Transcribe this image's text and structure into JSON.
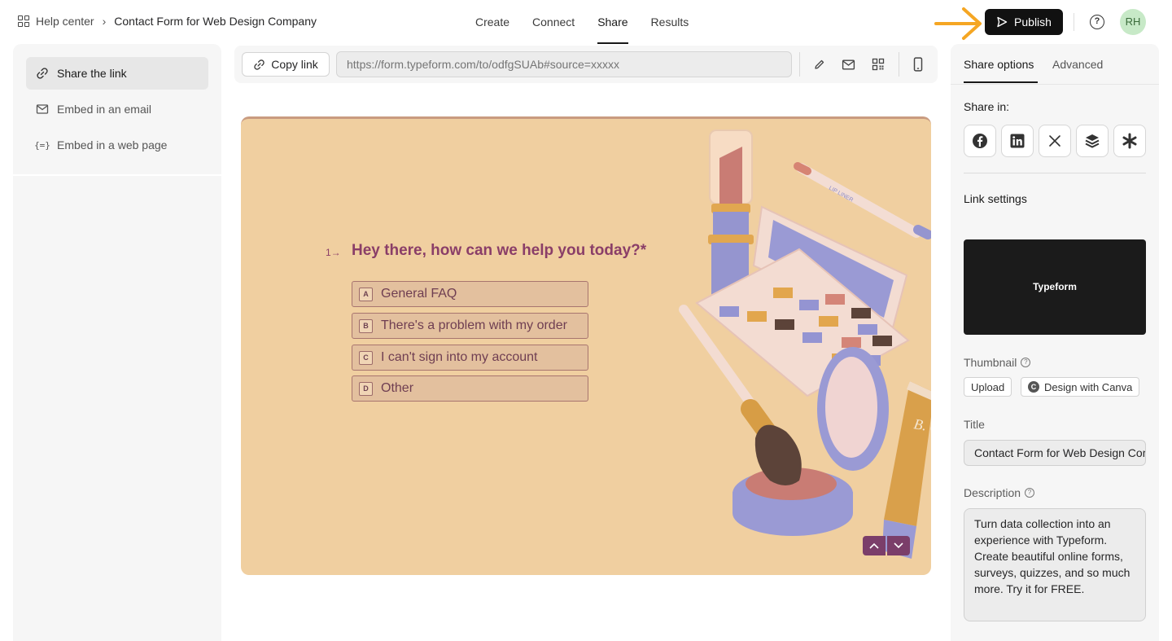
{
  "breadcrumb": {
    "home": "Help center",
    "separator": "›",
    "current": "Contact Form for Web Design Company"
  },
  "nav_tabs": [
    {
      "label": "Create"
    },
    {
      "label": "Connect"
    },
    {
      "label": "Share",
      "active": true
    },
    {
      "label": "Results"
    }
  ],
  "publish_label": "Publish",
  "help_icon": "?",
  "avatar_initials": "RH",
  "accent_color": "#f5a623",
  "left_menu": [
    {
      "label": "Share the link",
      "icon": "link-icon",
      "active": true
    },
    {
      "label": "Embed in an email",
      "icon": "mail-icon"
    },
    {
      "label": "Embed in a web page",
      "icon": "code-braces-icon",
      "glyph": "{=}"
    }
  ],
  "toolbar": {
    "copy_link_label": "Copy link",
    "url_placeholder": "https://form.typeform.com/to/odfgSUAb#source=xxxxx",
    "icons": [
      "pencil-icon",
      "mail-icon",
      "qr-code-icon",
      "mobile-preview-icon"
    ]
  },
  "form_preview": {
    "question_number": "1→",
    "question": "Hey there, how can we help you today?*",
    "choices": [
      {
        "key": "A",
        "label": "General FAQ"
      },
      {
        "key": "B",
        "label": "There's a problem with my order"
      },
      {
        "key": "C",
        "label": "I can't sign into my account"
      },
      {
        "key": "D",
        "label": "Other"
      }
    ],
    "illustration_text": {
      "liner": "LIP LINER",
      "tube": "B.\nCrea"
    },
    "background_color": "#f0cfa0",
    "text_color": "#8a3e68"
  },
  "right_panel": {
    "tabs": [
      {
        "label": "Share options",
        "active": true
      },
      {
        "label": "Advanced"
      }
    ],
    "share_in_label": "Share in:",
    "social_icons": [
      "facebook-icon",
      "linkedin-icon",
      "x-icon",
      "buffer-icon",
      "asterisk-icon"
    ],
    "link_settings_label": "Link settings",
    "preview_card_text": "Typeform",
    "thumbnail_label": "Thumbnail",
    "upload_label": "Upload",
    "canva_label": "Design with Canva",
    "title_label": "Title",
    "title_value": "Contact Form for Web Design Company",
    "description_label": "Description",
    "description_value": "Turn data collection into an experience with Typeform. Create beautiful online forms, surveys, quizzes, and so much more. Try it for FREE."
  }
}
